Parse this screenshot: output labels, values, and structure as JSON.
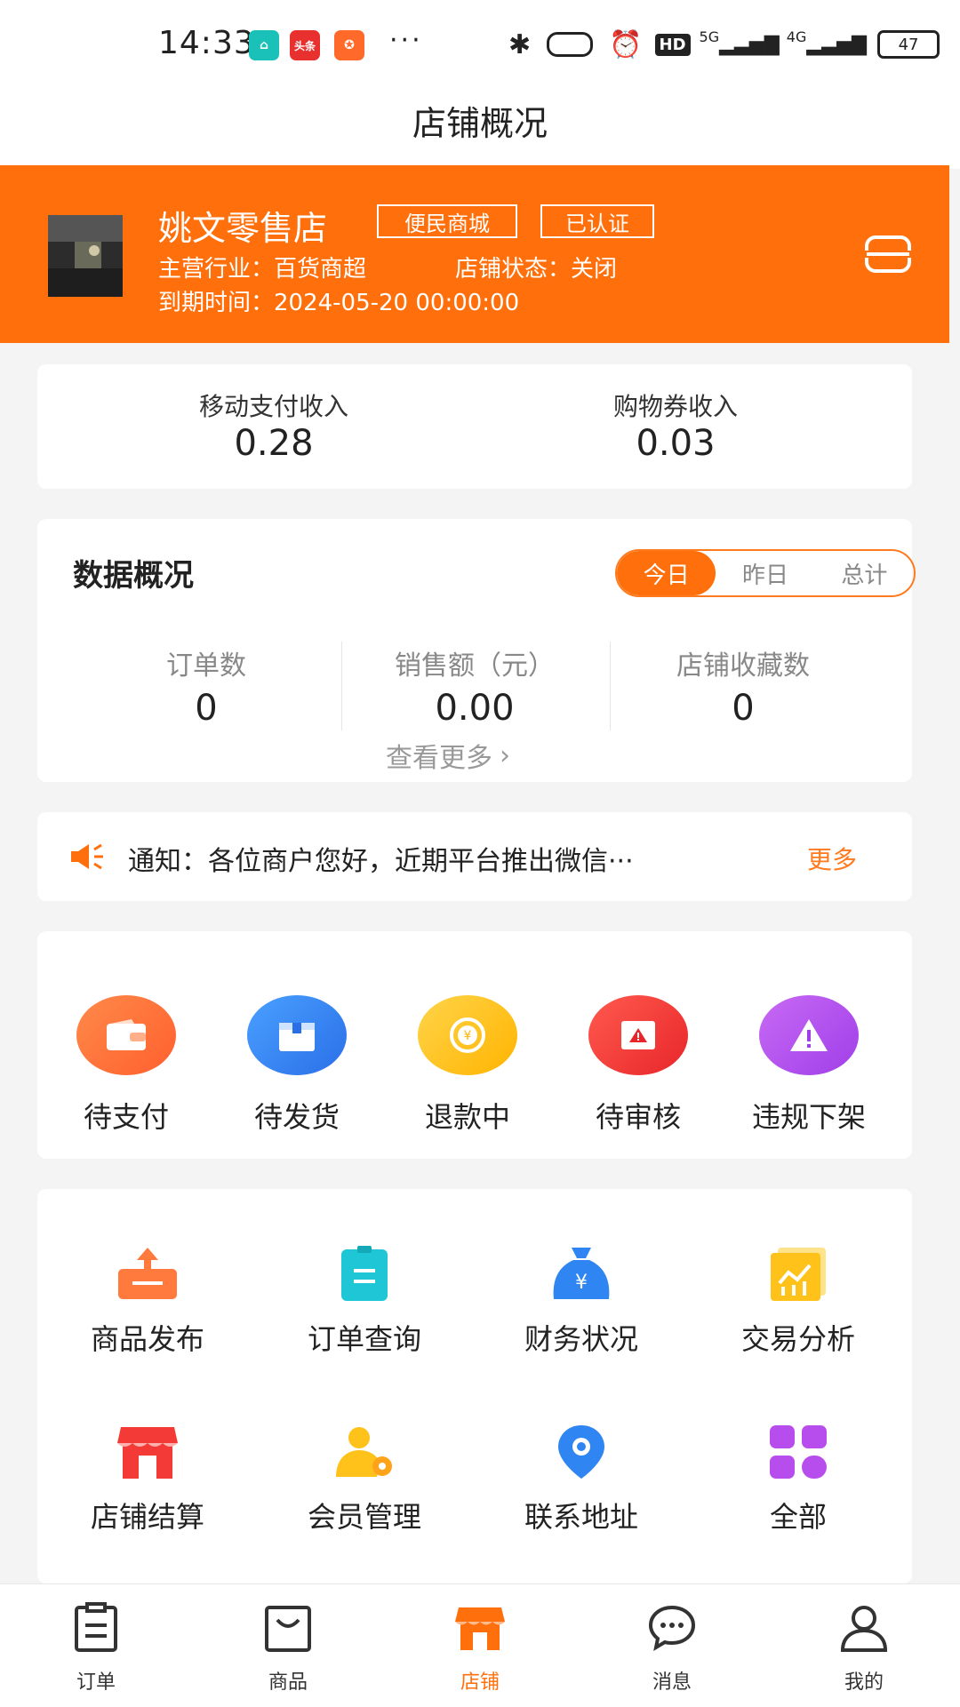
{
  "status_bar": {
    "time": "14:33",
    "app_icons": [
      "home-app-icon",
      "toutiao-app-icon",
      "taobao-app-icon"
    ],
    "toutiao_label": "头条",
    "more": "···",
    "battery": "47",
    "network_1": "5G",
    "network_2": "4G",
    "hd_label": "HD"
  },
  "title": "店铺概况",
  "store": {
    "name": "姚文零售店",
    "tags": [
      "便民商城",
      "已认证"
    ],
    "industry": "主营行业：百货商超",
    "status": "店铺状态：关闭",
    "expire": "到期时间：2024-05-20 00:00:00",
    "header_color": "#ff6f0b"
  },
  "income": [
    {
      "label": "移动支付收入",
      "value": "0.28"
    },
    {
      "label": "购物券收入",
      "value": "0.03"
    }
  ],
  "overview": {
    "title": "数据概况",
    "segments": [
      "今日",
      "昨日",
      "总计"
    ],
    "active_segment": "今日",
    "stats": [
      {
        "label": "订单数",
        "value": "0"
      },
      {
        "label": "销售额（元）",
        "value": "0.00"
      },
      {
        "label": "店铺收藏数",
        "value": "0"
      }
    ],
    "more": "查看更多"
  },
  "notice": {
    "text": "通知：各位商户您好，近期平台推出微信···",
    "more": "更多"
  },
  "order_status": [
    {
      "label": "待支付",
      "icon": "wallet-icon",
      "color": "#ff7a3c"
    },
    {
      "label": "待发货",
      "icon": "box-icon",
      "color": "#2f86f2"
    },
    {
      "label": "退款中",
      "icon": "refund-coin-icon",
      "color": "#ffc21a"
    },
    {
      "label": "待审核",
      "icon": "review-alert-icon",
      "color": "#f43a36"
    },
    {
      "label": "违规下架",
      "icon": "warning-icon",
      "color": "#b84dee"
    }
  ],
  "tools": [
    {
      "label": "商品发布",
      "icon": "upload-tray-icon",
      "color": "#ff7a3c"
    },
    {
      "label": "订单查询",
      "icon": "clipboard-list-icon",
      "color": "#1fc6d6"
    },
    {
      "label": "财务状况",
      "icon": "money-bag-icon",
      "color": "#2f86f2"
    },
    {
      "label": "交易分析",
      "icon": "chart-analysis-icon",
      "color": "#ffc21a"
    },
    {
      "label": "店铺结算",
      "icon": "storefront-icon",
      "color": "#f43a36"
    },
    {
      "label": "会员管理",
      "icon": "member-settings-icon",
      "color": "#ffb21a"
    },
    {
      "label": "联系地址",
      "icon": "location-pin-icon",
      "color": "#2f86f2"
    },
    {
      "label": "全部",
      "icon": "grid-all-icon",
      "color": "#b84dee"
    }
  ],
  "tab_bar": [
    {
      "label": "订单",
      "icon": "order-clipboard-icon"
    },
    {
      "label": "商品",
      "icon": "shopping-bag-icon"
    },
    {
      "label": "店铺",
      "icon": "store-tab-icon"
    },
    {
      "label": "消息",
      "icon": "chat-bubble-icon"
    },
    {
      "label": "我的",
      "icon": "user-profile-icon"
    }
  ],
  "active_tab": "店铺"
}
